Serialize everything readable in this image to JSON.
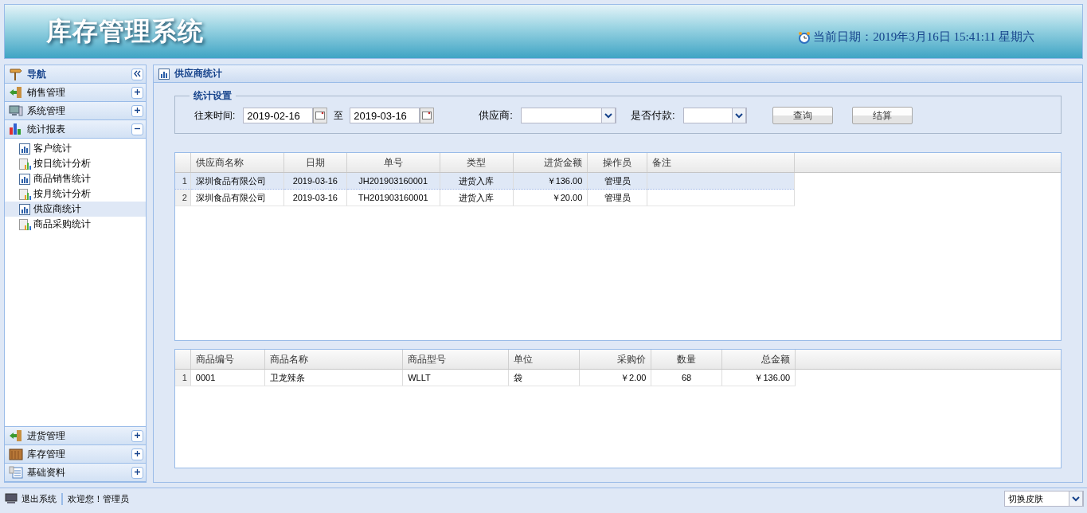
{
  "header": {
    "title": "库存管理系统",
    "date_text": "当前日期：2019年3月16日  15:41:11 星期六"
  },
  "nav": {
    "title": "导航",
    "sections": [
      {
        "label": "销售管理",
        "expanded": false
      },
      {
        "label": "系统管理",
        "expanded": false
      },
      {
        "label": "统计报表",
        "expanded": true,
        "children": [
          {
            "label": "客户统计",
            "selected": false
          },
          {
            "label": "按日统计分析",
            "selected": false
          },
          {
            "label": "商品销售统计",
            "selected": false
          },
          {
            "label": "按月统计分析",
            "selected": false
          },
          {
            "label": "供应商统计",
            "selected": true
          },
          {
            "label": "商品采购统计",
            "selected": false
          }
        ]
      },
      {
        "label": "进货管理",
        "expanded": false
      },
      {
        "label": "库存管理",
        "expanded": false
      },
      {
        "label": "基础资料",
        "expanded": false
      }
    ]
  },
  "panel": {
    "title": "供应商统计",
    "filter": {
      "legend": "统计设置",
      "period_label": "往来时间:",
      "date_from": "2019-02-16",
      "to_label": "至",
      "date_to": "2019-03-16",
      "supplier_label": "供应商:",
      "paid_label": "是否付款:",
      "buttons": [
        "查询",
        "结算"
      ]
    }
  },
  "grid1": {
    "columns": [
      "供应商名称",
      "日期",
      "单号",
      "类型",
      "进货金额",
      "操作员",
      "备注"
    ],
    "rows": [
      {
        "number": "1",
        "selected": true,
        "cells": [
          "深圳食品有限公司",
          "2019-03-16",
          "JH201903160001",
          "进货入库",
          "￥136.00",
          "管理员",
          ""
        ]
      },
      {
        "number": "2",
        "selected": false,
        "cells": [
          "深圳食品有限公司",
          "2019-03-16",
          "TH201903160001",
          "进货入库",
          "￥20.00",
          "管理员",
          ""
        ]
      }
    ]
  },
  "grid2": {
    "columns": [
      "商品编号",
      "商品名称",
      "商品型号",
      "单位",
      "采购价",
      "数量",
      "总金额"
    ],
    "rows": [
      {
        "number": "1",
        "selected": false,
        "cells": [
          "0001",
          "卫龙辣条",
          "WLLT",
          "袋",
          "￥2.00",
          "68",
          "￥136.00"
        ]
      }
    ]
  },
  "footer": {
    "logout": "退出系统",
    "welcome": "欢迎您！管理员",
    "skin_select": "切换皮肤"
  }
}
